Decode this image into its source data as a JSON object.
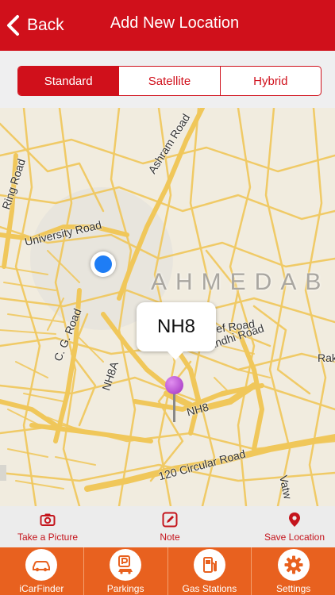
{
  "navbar": {
    "back_label": "Back",
    "title": "Add New Location",
    "background_color": "#d0101b"
  },
  "map_type": {
    "options": [
      "Standard",
      "Satellite",
      "Hybrid"
    ],
    "selected": "Standard"
  },
  "map": {
    "city": "AHMEDAB",
    "roads": {
      "ashram": "Ashram Road",
      "ring": "Ring Road",
      "university": "University Road",
      "cg": "C. G. Road",
      "nh8a": "NH8A",
      "nh8": "NH8",
      "circular": "120 Circular Road",
      "relief": "elief Road",
      "gandhi": "andhi Road",
      "rak": "Rak",
      "vatw": "Vatw"
    },
    "callout": "NH8",
    "pin_color": "#b64fd2",
    "user_location_color": "#1e7df5"
  },
  "actions": [
    {
      "label": "Take a Picture",
      "icon": "camera-icon"
    },
    {
      "label": "Note",
      "icon": "note-icon"
    },
    {
      "label": "Save Location",
      "icon": "location-pin-icon"
    }
  ],
  "tabs": [
    {
      "label": "iCarFinder",
      "icon": "car-icon"
    },
    {
      "label": "Parkings",
      "icon": "parking-icon"
    },
    {
      "label": "Gas Stations",
      "icon": "gas-pump-icon"
    },
    {
      "label": "Settings",
      "icon": "gear-icon"
    }
  ],
  "tab_bar_color": "#e8611f"
}
